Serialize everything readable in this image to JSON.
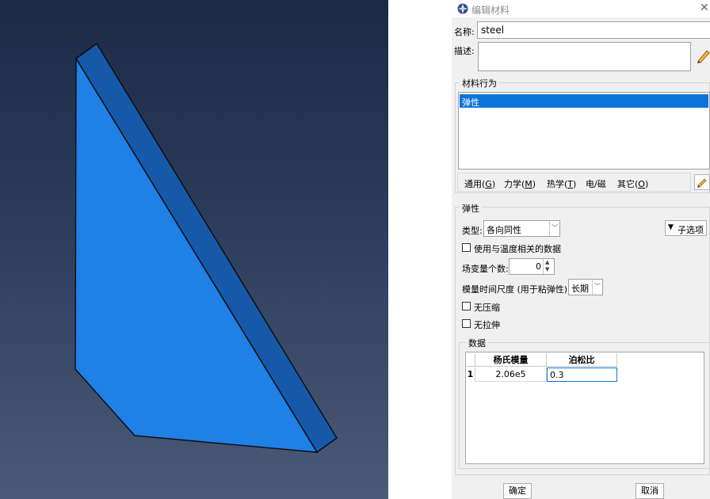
{
  "dialog": {
    "title": "编辑材料",
    "name_label": "名称:",
    "name_value": "steel",
    "description_label": "描述:",
    "description_value": "",
    "behaviors_group": "材料行为",
    "behaviors": [
      "弹性"
    ],
    "selected_behavior": "弹性",
    "menus": [
      {
        "label": "通用",
        "mnemonic": "G"
      },
      {
        "label": "力学",
        "mnemonic": "M"
      },
      {
        "label": "热学",
        "mnemonic": "T"
      },
      {
        "label": "电/磁",
        "mnemonic": ""
      },
      {
        "label": "其它",
        "mnemonic": "O"
      }
    ]
  },
  "elastic": {
    "group_title": "弹性",
    "type_label": "类型:",
    "type_value": "各向同性",
    "suboptions_label": "子选项",
    "temp_dependent_label": "使用与温度相关的数据",
    "temp_dependent_checked": false,
    "field_vars_label": "场变量个数:",
    "field_vars_value": "0",
    "timescale_label": "模量时间尺度 (用于粘弹性):",
    "timescale_value": "长期",
    "no_compression_label": "无压缩",
    "no_compression_checked": false,
    "no_tension_label": "无拉伸",
    "no_tension_checked": false
  },
  "data_table": {
    "group_title": "数据",
    "columns": [
      "杨氏模量",
      "泊松比"
    ],
    "rows": [
      {
        "index": "1",
        "youngs_modulus": "2.06e5",
        "poisson": "0.3"
      }
    ]
  },
  "buttons": {
    "ok": "确定",
    "cancel": "取消"
  },
  "colors": {
    "viewport_top": "#1b2a45",
    "viewport_bottom": "#4a5a76",
    "part_face": "#1f80e6",
    "part_side": "#1659a8",
    "selection": "#0a74da"
  }
}
